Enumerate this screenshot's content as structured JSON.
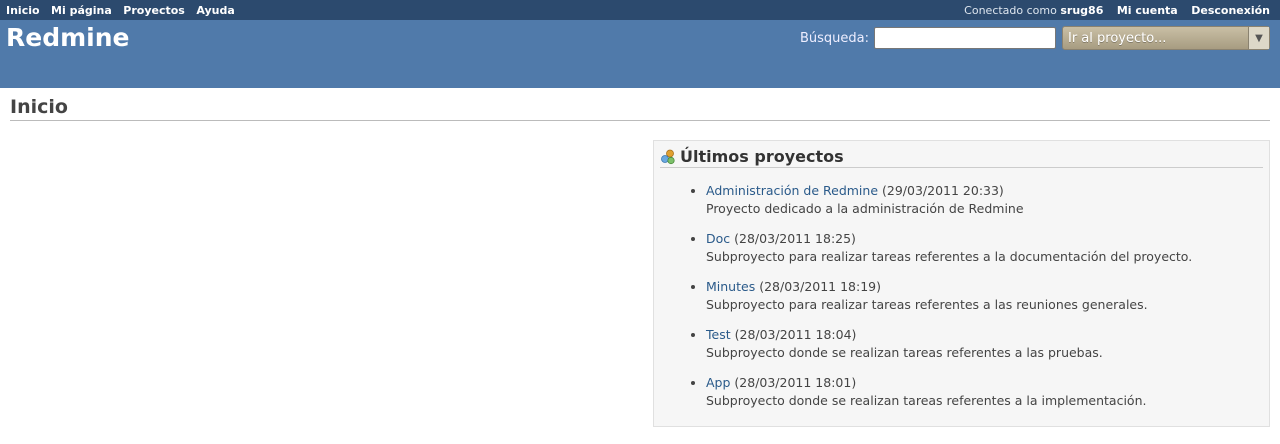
{
  "top_menu": {
    "left": [
      "Inicio",
      "Mi página",
      "Proyectos",
      "Ayuda"
    ],
    "logged_as_prefix": "Conectado como",
    "username": "srug86",
    "account": "Mi cuenta",
    "logout": "Desconexión"
  },
  "header": {
    "app_title": "Redmine",
    "search_label": "Búsqueda:",
    "search_value": "",
    "project_jump": "Ir al proyecto..."
  },
  "main": {
    "title": "Inicio",
    "latest_projects": {
      "title": "Últimos proyectos",
      "items": [
        {
          "name": "Administración de Redmine",
          "date": "(29/03/2011 20:33)",
          "desc": "Proyecto dedicado a la administración de Redmine"
        },
        {
          "name": "Doc",
          "date": "(28/03/2011 18:25)",
          "desc": "Subproyecto para realizar tareas referentes a la documentación del proyecto."
        },
        {
          "name": "Minutes",
          "date": "(28/03/2011 18:19)",
          "desc": "Subproyecto para realizar tareas referentes a las reuniones generales."
        },
        {
          "name": "Test",
          "date": "(28/03/2011 18:04)",
          "desc": "Subproyecto donde se realizan tareas referentes a las pruebas."
        },
        {
          "name": "App",
          "date": "(28/03/2011 18:01)",
          "desc": "Subproyecto donde se realizan tareas referentes a la implementación."
        }
      ]
    }
  },
  "colors": {
    "top_menu_bg": "#2c4a6e",
    "header_bg": "#507aaa",
    "link": "#2a5a8a"
  }
}
